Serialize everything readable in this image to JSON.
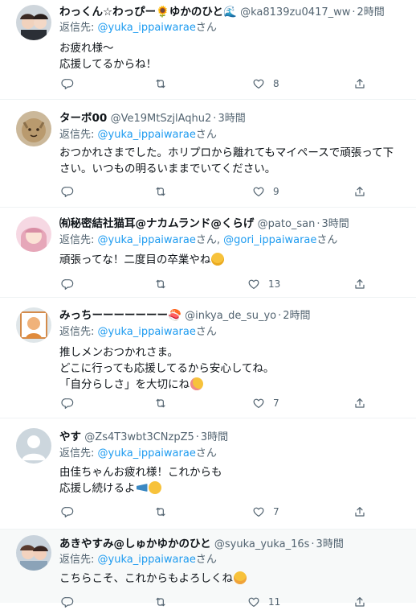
{
  "reply_prefix": "返信先: ",
  "mention_suffix": "さん",
  "separator": "·",
  "more_glyph": "···",
  "colors": {
    "link": "#1d9bf0",
    "muted": "#536471",
    "text": "#0f1419",
    "highlight_bg": "#f7f9f9"
  },
  "tweets": [
    {
      "name": "わっくん☆わっぴー🌻ゆかのひと🌊",
      "handle": "@ka8139zu0417_ww",
      "time": "2時間",
      "reply_mention": "@yuka_ippaiwarae",
      "reply_mention2": "",
      "text": "お疲れ様～\n応援してるからね！",
      "like_count": "8",
      "reply_count": "",
      "retweet_count": ""
    },
    {
      "name": "ターボ00",
      "handle": "@Ve19MtSzjlAqhu2",
      "time": "3時間",
      "reply_mention": "@yuka_ippaiwarae",
      "reply_mention2": "",
      "text": "おつかれさまでした。ホリプロから離れてもマイペースで頑張って下さい。いつもの明るいままでいてください。",
      "like_count": "9",
      "reply_count": "",
      "retweet_count": ""
    },
    {
      "name": "㈲秘密結社猫耳@ナカムランド@くらげ",
      "handle": "@pato_san",
      "time": "3時間",
      "reply_mention": "@yuka_ippaiwarae",
      "reply_mention2": "@gori_ippaiwarae",
      "text": "頑張ってな！二度目の卒業やね",
      "like_count": "13",
      "reply_count": "",
      "retweet_count": ""
    },
    {
      "name": "みっちーーーーーーー🍣",
      "handle": "@inkya_de_su_yo",
      "time": "2時間",
      "reply_mention": "@yuka_ippaiwarae",
      "reply_mention2": "",
      "text": "推しメンおつかれさま。\nどこに行っても応援してるから安心してね。\n「自分らしさ」を大切にね",
      "like_count": "7",
      "reply_count": "",
      "retweet_count": ""
    },
    {
      "name": "やす",
      "handle": "@Zs4T3wbt3CNzpZ5",
      "time": "3時間",
      "reply_mention": "@yuka_ippaiwarae",
      "reply_mention2": "",
      "text": "由佳ちゃんお疲れ様！これからも\n応援し続けるよ",
      "like_count": "7",
      "reply_count": "",
      "retweet_count": ""
    },
    {
      "name": "あきやすみ@しゅかゆかのひと",
      "handle": "@syuka_yuka_16s",
      "time": "3時間",
      "reply_mention": "@yuka_ippaiwarae",
      "reply_mention2": "",
      "text": "こちらこそ、これからもよろしくね",
      "like_count": "11",
      "reply_count": "",
      "retweet_count": ""
    }
  ]
}
